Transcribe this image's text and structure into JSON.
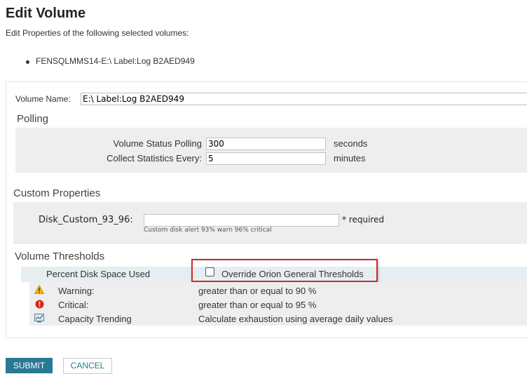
{
  "page": {
    "title": "Edit Volume",
    "subtitle": "Edit Properties of the following selected volumes:",
    "selected_volumes": [
      "FENSQLMMS14-E:\\ Label:Log B2AED949"
    ]
  },
  "volume_name": {
    "label": "Volume Name:",
    "value": "E:\\ Label:Log B2AED949"
  },
  "polling": {
    "title": "Polling",
    "status_label": "Volume Status Polling",
    "status_value": "300",
    "status_unit": "seconds",
    "stats_label": "Collect Statistics Every:",
    "stats_value": "5",
    "stats_unit": "minutes"
  },
  "custom_properties": {
    "title": "Custom Properties",
    "field_label": "Disk_Custom_93_96:",
    "field_value": "",
    "required_text": "* required",
    "help_text": "Custom disk alert 93% warn 96% critical"
  },
  "thresholds": {
    "title": "Volume Thresholds",
    "metric_label": "Percent Disk Space Used",
    "override_label": "Override Orion General Thresholds",
    "override_checked": false,
    "rows": [
      {
        "icon": "warning-icon",
        "label": "Warning:",
        "value": "greater than or equal to 90 %"
      },
      {
        "icon": "critical-icon",
        "label": "Critical:",
        "value": "greater than or equal to 95 %"
      },
      {
        "icon": "capacity-trend-icon",
        "label": "Capacity Trending",
        "value": "Calculate exhaustion using average daily values"
      }
    ]
  },
  "buttons": {
    "submit": "SUBMIT",
    "cancel": "CANCEL"
  },
  "colors": {
    "accent": "#297994",
    "highlight_border": "#d12a2a",
    "warning": "#f4b400",
    "critical": "#d9261c"
  }
}
